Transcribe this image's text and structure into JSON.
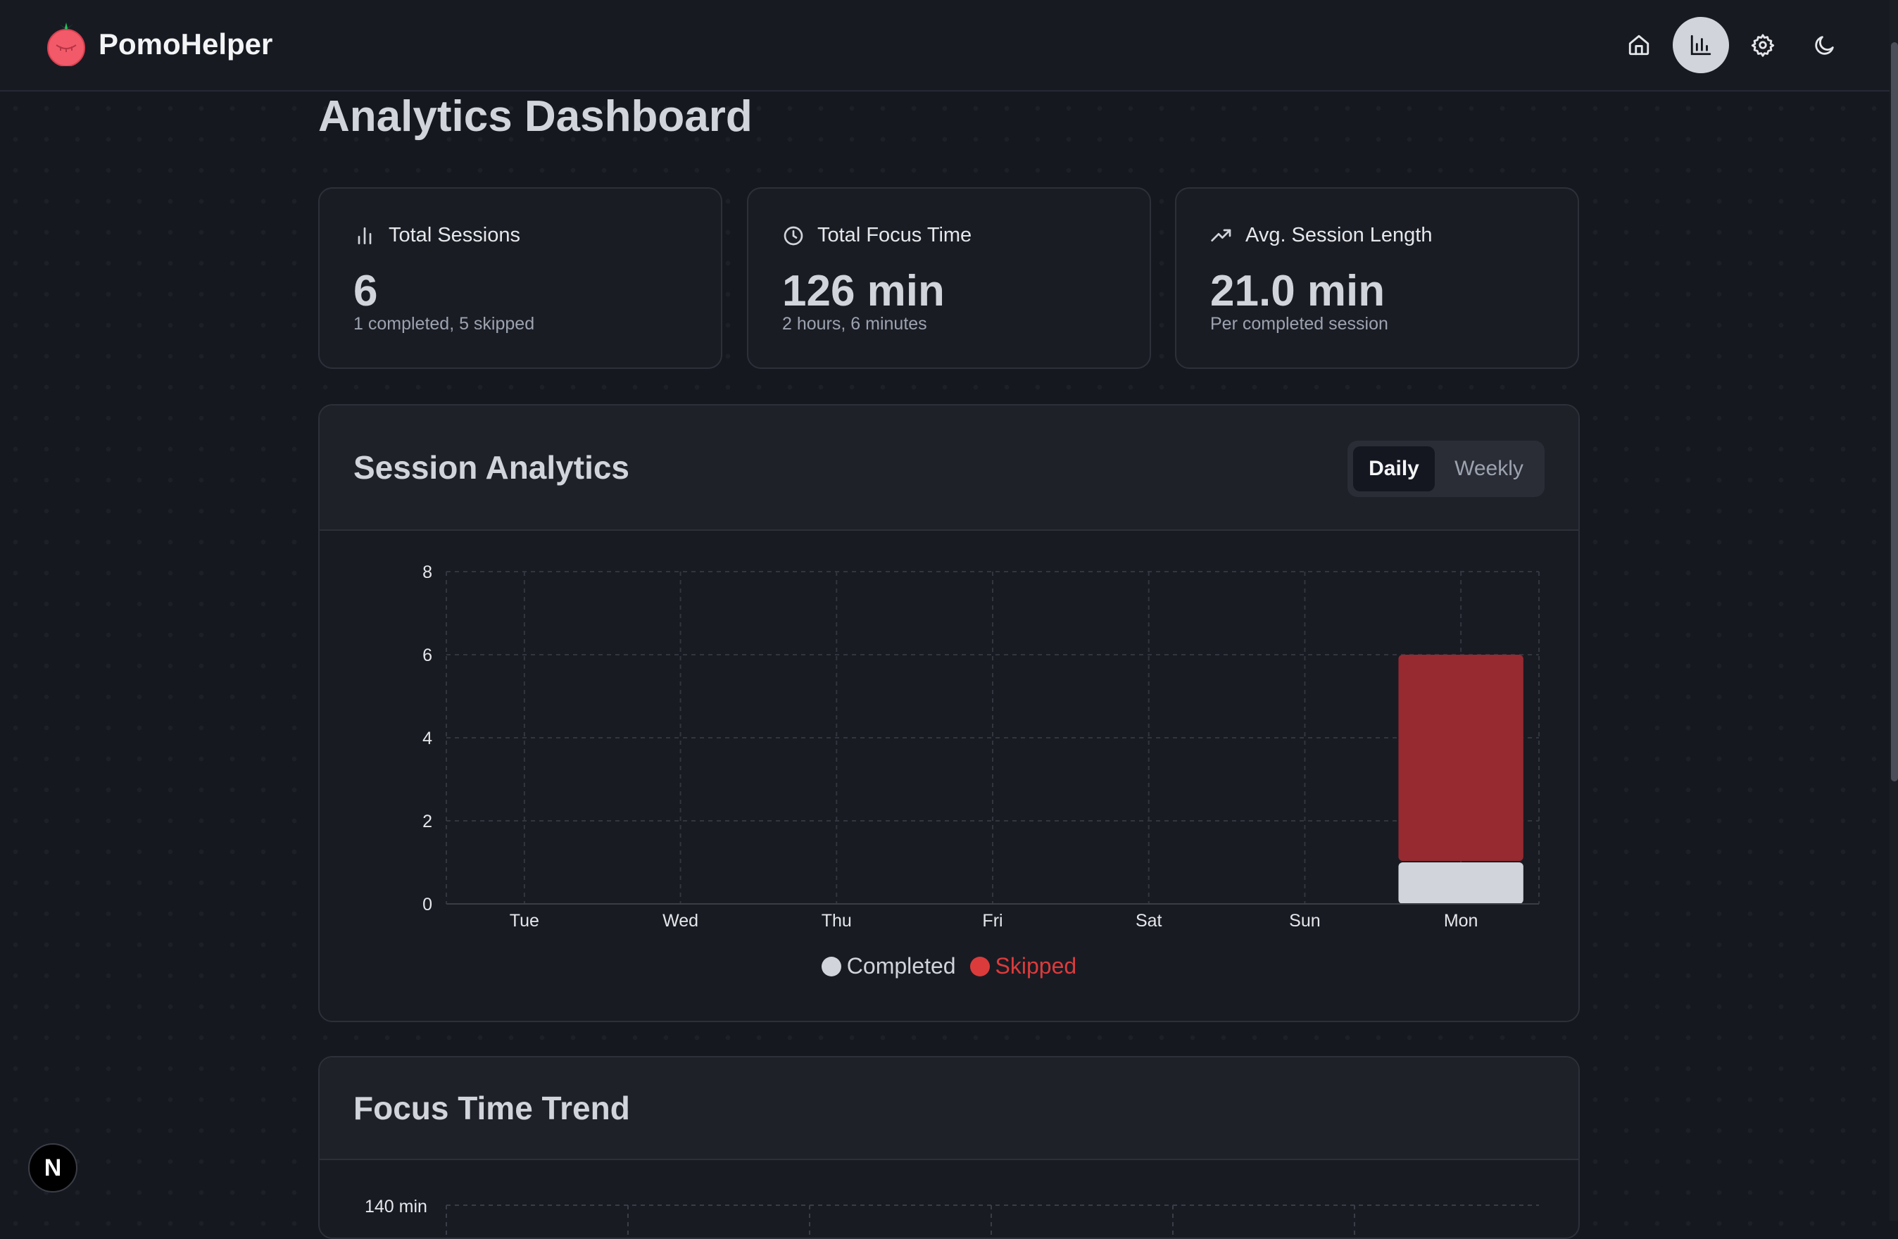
{
  "app": {
    "name": "PomoHelper"
  },
  "nav": {
    "items": [
      {
        "icon": "home-icon",
        "active": false
      },
      {
        "icon": "bar-chart-icon",
        "active": true
      },
      {
        "icon": "gear-icon",
        "active": false
      },
      {
        "icon": "moon-icon",
        "active": false
      }
    ]
  },
  "page": {
    "title": "Analytics Dashboard"
  },
  "stats": [
    {
      "icon": "bar-chart-icon",
      "label": "Total Sessions",
      "value": "6",
      "sub": "1 completed, 5 skipped"
    },
    {
      "icon": "clock-icon",
      "label": "Total Focus Time",
      "value": "126 min",
      "sub": "2 hours, 6 minutes"
    },
    {
      "icon": "trending-up-icon",
      "label": "Avg. Session Length",
      "value": "21.0 min",
      "sub": "Per completed session"
    }
  ],
  "session_panel": {
    "title": "Session Analytics",
    "toggle": {
      "daily": "Daily",
      "weekly": "Weekly",
      "selected": "Daily"
    }
  },
  "trend_panel": {
    "title": "Focus Time Trend",
    "first_tick": "140 min"
  },
  "fab": {
    "label": "N"
  },
  "colors": {
    "completed": "#d1d5db",
    "skipped": "#962a30",
    "skipped_text": "#dc3b3b",
    "accent": "#f25a6a"
  },
  "chart_data": {
    "type": "bar",
    "stacked": true,
    "categories": [
      "Tue",
      "Wed",
      "Thu",
      "Fri",
      "Sat",
      "Sun",
      "Mon"
    ],
    "series": [
      {
        "name": "Completed",
        "values": [
          0,
          0,
          0,
          0,
          0,
          0,
          1
        ]
      },
      {
        "name": "Skipped",
        "values": [
          0,
          0,
          0,
          0,
          0,
          0,
          5
        ]
      }
    ],
    "yticks": [
      0,
      2,
      4,
      6,
      8
    ],
    "ylim": [
      0,
      8
    ],
    "grid": true,
    "legend": "bottom-center"
  }
}
